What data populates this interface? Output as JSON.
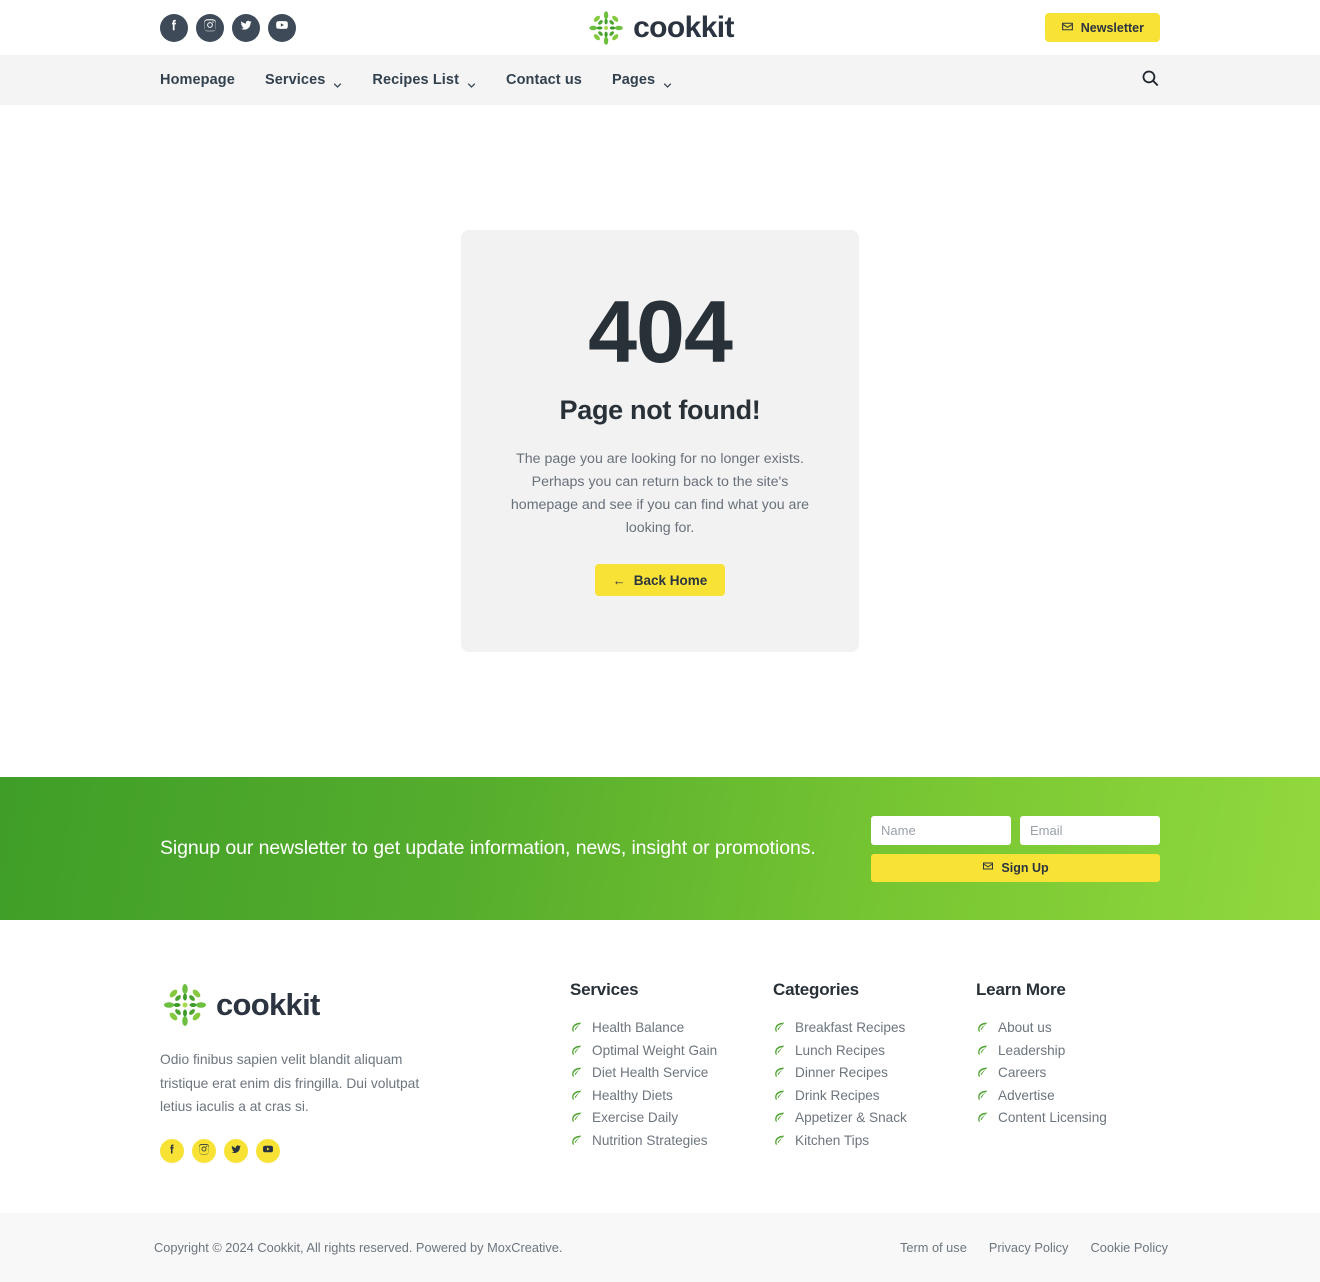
{
  "brand": {
    "name": "cookkit",
    "logo_icon": "leaf-burst-logo-icon"
  },
  "topbar": {
    "social": [
      {
        "name": "facebook",
        "icon": "facebook-icon"
      },
      {
        "name": "instagram",
        "icon": "instagram-icon"
      },
      {
        "name": "twitter",
        "icon": "twitter-icon"
      },
      {
        "name": "youtube",
        "icon": "youtube-icon"
      }
    ],
    "newsletter_label": "Newsletter",
    "newsletter_icon": "envelope-icon"
  },
  "nav": {
    "items": [
      {
        "label": "Homepage",
        "has_dropdown": false
      },
      {
        "label": "Services",
        "has_dropdown": true
      },
      {
        "label": "Recipes List",
        "has_dropdown": true
      },
      {
        "label": "Contact us",
        "has_dropdown": false
      },
      {
        "label": "Pages",
        "has_dropdown": true
      }
    ],
    "search_icon": "search-icon"
  },
  "error_page": {
    "code": "404",
    "title": "Page not found!",
    "description": "The page you are looking for no longer exists. Perhaps you can return back to the site's homepage and see if you can find what you are looking for.",
    "button_label": "Back Home",
    "button_icon": "arrow-left-icon",
    "arrow_glyph": "←"
  },
  "newsletter_band": {
    "heading": "Signup our newsletter to get update information, news, insight or promotions.",
    "name_placeholder": "Name",
    "name_value": "",
    "email_placeholder": "Email",
    "email_value": "",
    "signup_label": "Sign Up",
    "signup_icon": "envelope-icon",
    "gradient_from": "#3f9e28",
    "gradient_to": "#92d93e"
  },
  "footer": {
    "description": "Odio finibus sapien velit blandit aliquam tristique erat enim dis fringilla. Dui volutpat letius iaculis a at cras si.",
    "social": [
      {
        "name": "facebook",
        "icon": "facebook-icon"
      },
      {
        "name": "instagram",
        "icon": "instagram-icon"
      },
      {
        "name": "twitter",
        "icon": "twitter-icon"
      },
      {
        "name": "youtube",
        "icon": "youtube-icon"
      }
    ],
    "columns": [
      {
        "heading": "Services",
        "links": [
          "Health Balance",
          "Optimal Weight Gain",
          "Diet Health Service",
          "Healthy Diets",
          "Exercise Daily",
          "Nutrition Strategies"
        ]
      },
      {
        "heading": "Categories",
        "links": [
          "Breakfast Recipes",
          "Lunch Recipes",
          "Dinner Recipes",
          "Drink Recipes",
          "Appetizer & Snack",
          "Kitchen Tips"
        ]
      },
      {
        "heading": "Learn More",
        "links": [
          "About us",
          "Leadership",
          "Careers",
          "Advertise",
          "Content Licensing"
        ]
      }
    ]
  },
  "bottombar": {
    "copyright": "Copyright © 2024 Cookkit, All rights reserved. Powered by MoxCreative.",
    "legal": [
      "Term of use",
      "Privacy Policy",
      "Cookie Policy"
    ]
  },
  "colors": {
    "accent_yellow": "#f7e235",
    "green_dark": "#3f9e28",
    "green_light": "#92d93e",
    "text_dark": "#283038",
    "text_muted": "#6d757e",
    "card_bg": "#f2f2f2",
    "nav_bg": "#f4f4f4"
  }
}
